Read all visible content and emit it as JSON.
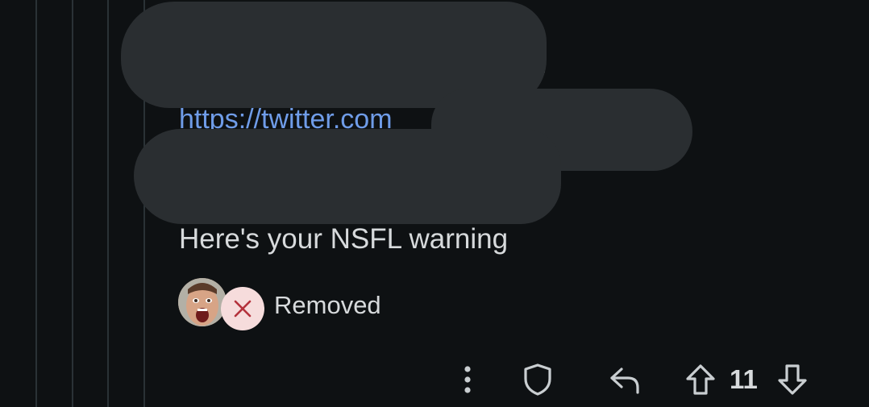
{
  "comment": {
    "link_text": "https://twitter.com",
    "body": "Here's your NSFL warning",
    "status": {
      "label": "Removed",
      "icon": "close-icon"
    },
    "actions": {
      "more_icon": "more-vertical-icon",
      "mod_icon": "shield-icon",
      "reply_icon": "reply-icon",
      "upvote_icon": "arrow-up-icon",
      "downvote_icon": "arrow-down-icon",
      "score": "11"
    }
  },
  "colors": {
    "background": "#0e1113",
    "text": "#d7dadc",
    "link": "#6f9ce8",
    "redaction": "#2a2e31",
    "removed_badge_bg": "#f6dcdc",
    "removed_badge_icon": "#b4323c"
  }
}
